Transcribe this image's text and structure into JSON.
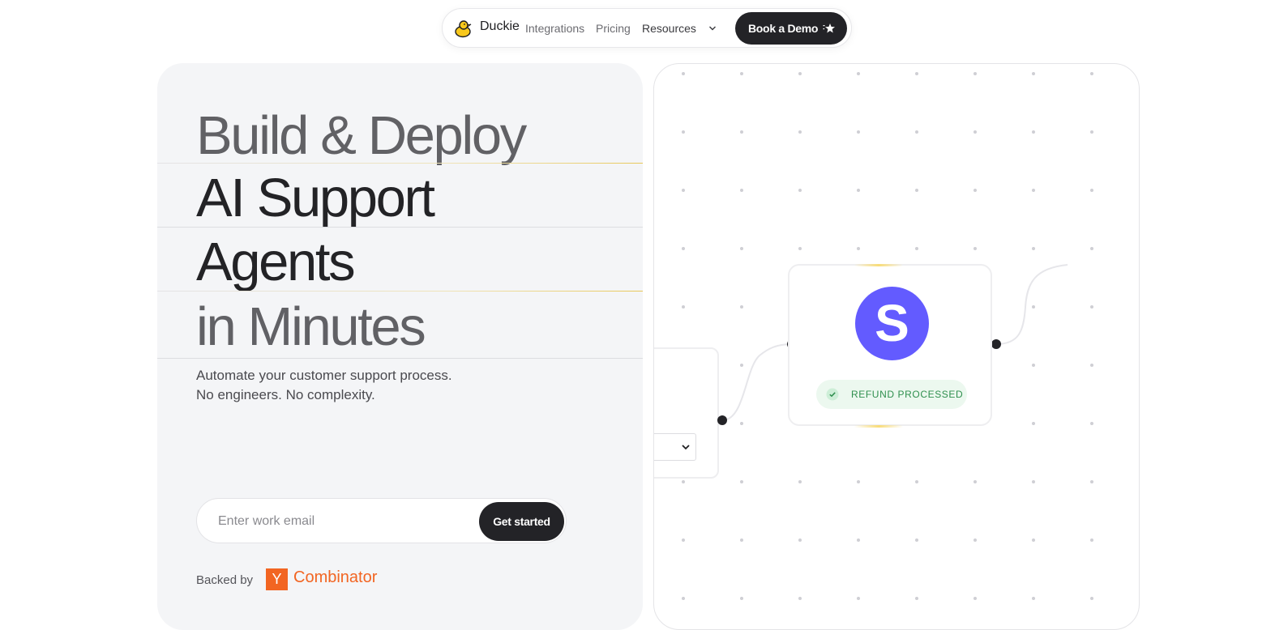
{
  "nav": {
    "brand": "Duckie",
    "links": [
      "Integrations",
      "Pricing",
      "Resources"
    ],
    "cta": "Book a Demo"
  },
  "hero": {
    "line1": "Build & Deploy",
    "line2": "AI Support",
    "line3": "Agents",
    "line4": "in Minutes",
    "sub1": "Automate your customer support process.",
    "sub2": "No engineers. No complexity.",
    "email_placeholder": "Enter work email",
    "cta": "Get started",
    "backed": "Backed by",
    "yc_letter": "Y",
    "yc_name": "Combinator"
  },
  "flow": {
    "node_letter": "S",
    "node_color": "#635bff",
    "status": "REFUND PROCESSED"
  },
  "colors": {
    "dark": "#232327",
    "accent_yellow": "#e8c85a",
    "yc_orange": "#f26522",
    "success_green": "#2f8f4e"
  }
}
